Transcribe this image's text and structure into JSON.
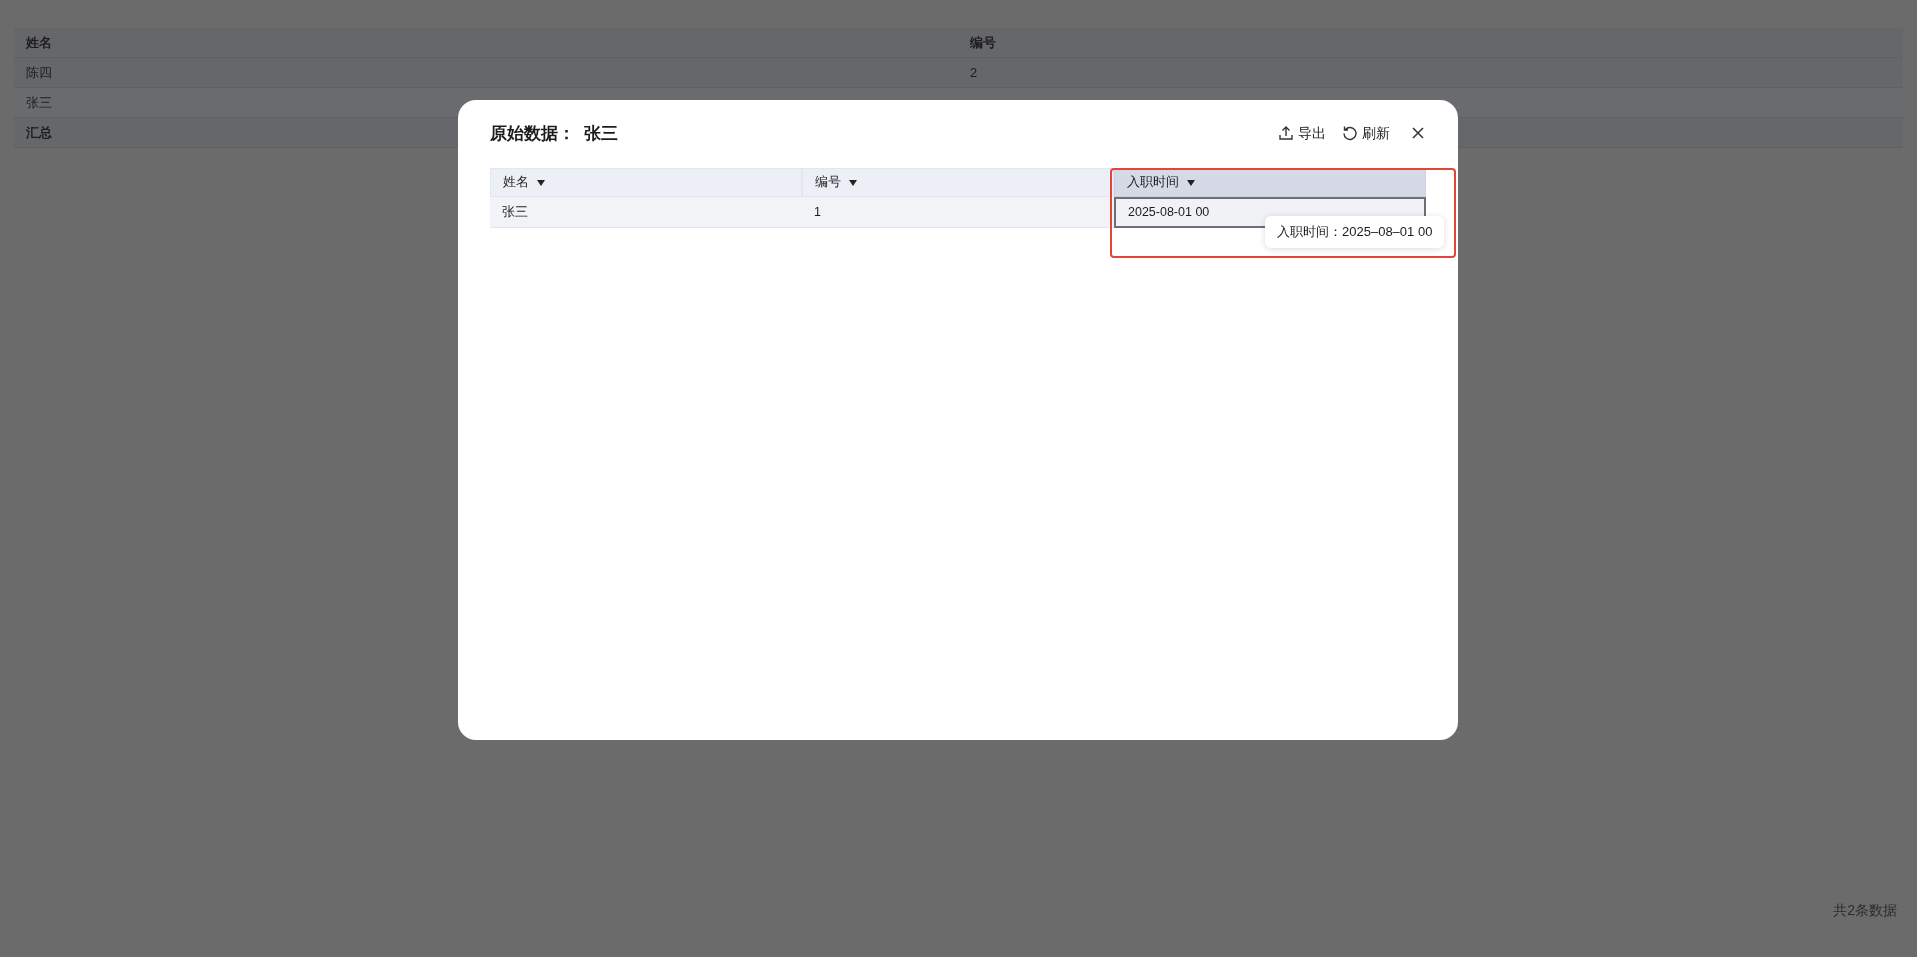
{
  "background_table": {
    "columns": [
      "姓名",
      "编号"
    ],
    "rows": [
      {
        "kind": "data",
        "cells": [
          "陈四",
          "2"
        ]
      },
      {
        "kind": "data",
        "cells": [
          "张三"
        ]
      },
      {
        "kind": "total",
        "cells": [
          "汇总"
        ]
      }
    ]
  },
  "footer": {
    "total": "共2条数据"
  },
  "dialog": {
    "title": "原始数据：  张三",
    "actions": [
      {
        "kind": "export",
        "label": "导出"
      },
      {
        "kind": "refresh",
        "label": "刷新"
      }
    ],
    "table": {
      "columns": [
        {
          "label": "姓名",
          "selected": false
        },
        {
          "label": "编号",
          "selected": false
        },
        {
          "label": "入职时间",
          "selected": true
        }
      ],
      "rows": [
        {
          "cells": [
            {
              "text": "张三",
              "selected": false
            },
            {
              "text": "1",
              "selected": false
            },
            {
              "text": "2025-08-01 00",
              "selected": true
            }
          ]
        }
      ]
    },
    "tooltip": "入职时间：2025–08–01 00",
    "highlight_box": true
  }
}
